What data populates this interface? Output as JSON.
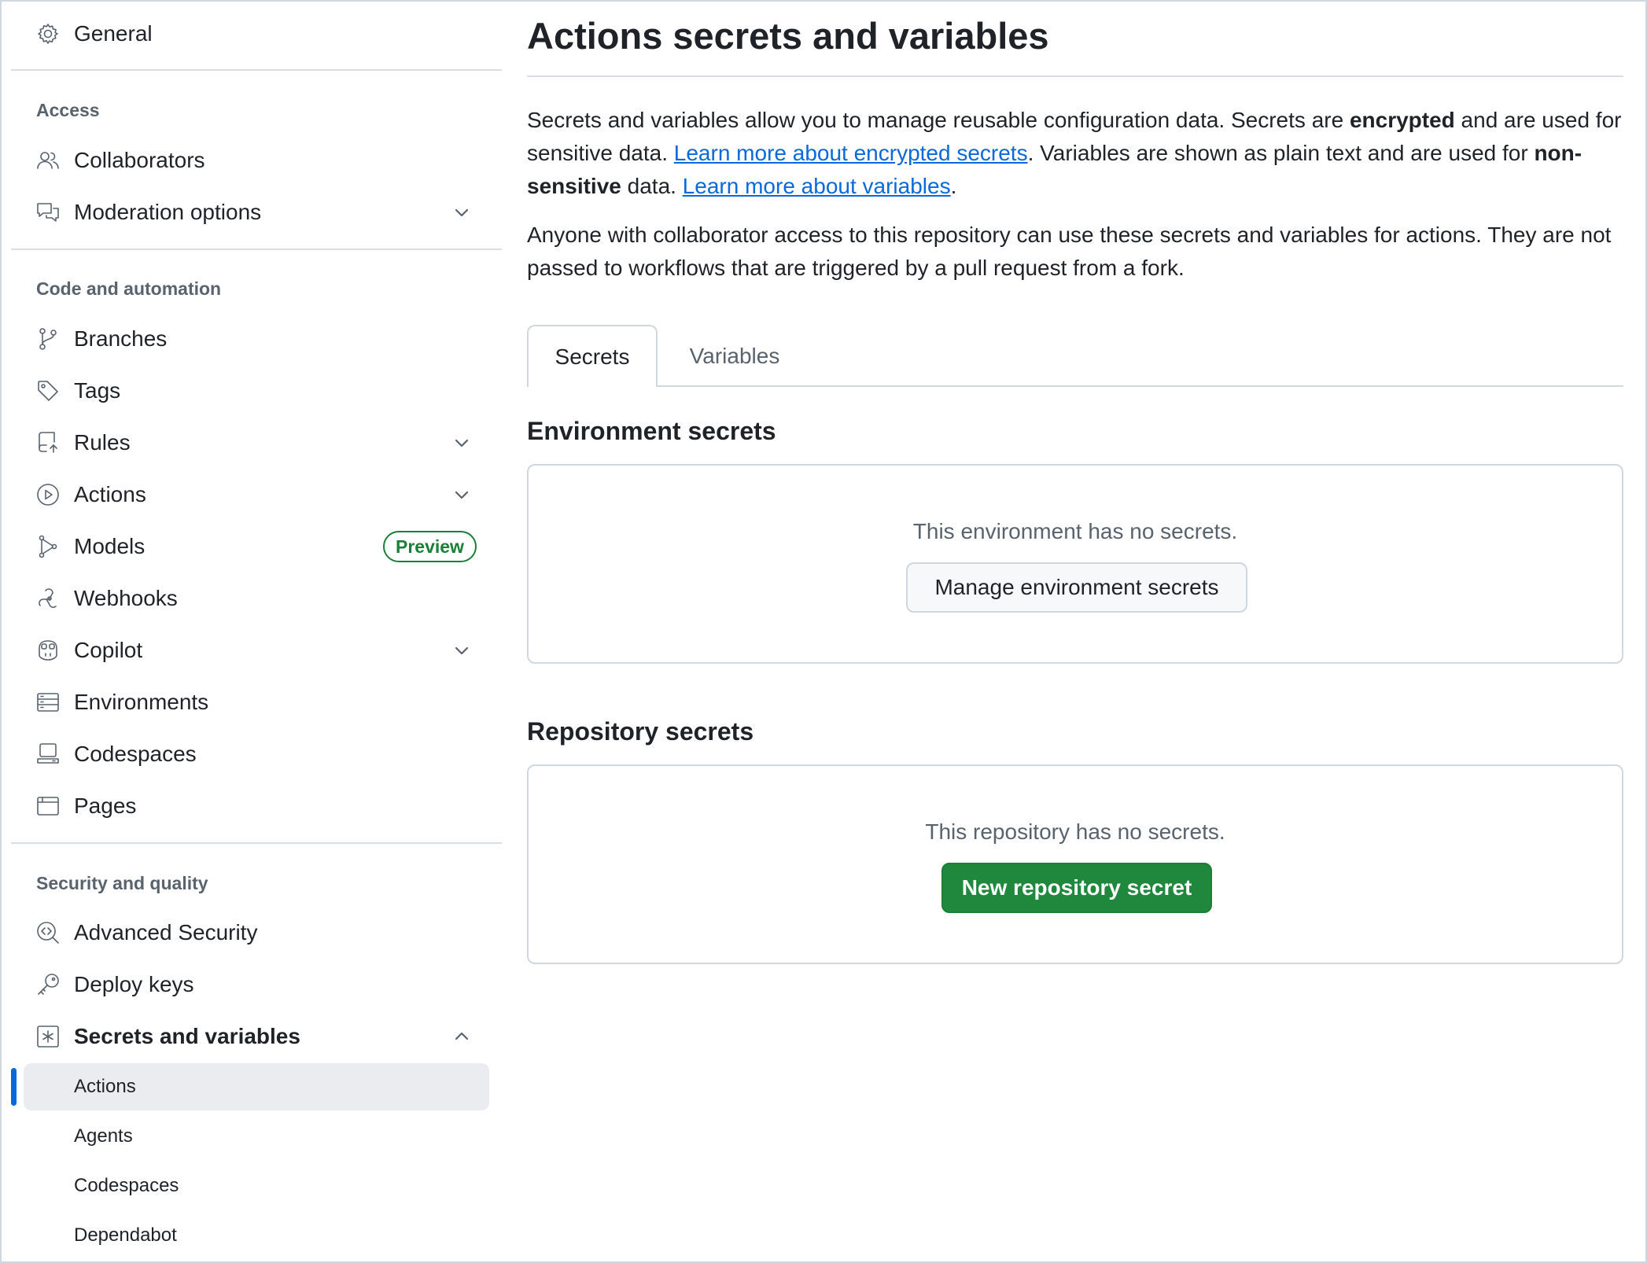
{
  "sidebar": {
    "general": "General",
    "sections": {
      "access": "Access",
      "code_automation": "Code and automation",
      "security_quality": "Security and quality"
    },
    "items": {
      "collaborators": "Collaborators",
      "moderation": "Moderation options",
      "branches": "Branches",
      "tags": "Tags",
      "rules": "Rules",
      "actions": "Actions",
      "models": "Models",
      "models_badge": "Preview",
      "webhooks": "Webhooks",
      "copilot": "Copilot",
      "environments": "Environments",
      "codespaces": "Codespaces",
      "pages": "Pages",
      "advanced_security": "Advanced Security",
      "deploy_keys": "Deploy keys",
      "secrets_variables": "Secrets and variables"
    },
    "sub_items": {
      "actions": "Actions",
      "agents": "Agents",
      "codespaces": "Codespaces",
      "dependabot": "Dependabot"
    },
    "icons": [
      "gear-icon",
      "people-icon",
      "comment-discussion-icon",
      "git-branch-icon",
      "tag-icon",
      "repo-push-icon",
      "play-icon",
      "ai-model-icon",
      "webhook-icon",
      "copilot-icon",
      "server-icon",
      "codespaces-icon",
      "browser-icon",
      "shield-search-icon",
      "key-icon",
      "key-asterisk-icon"
    ]
  },
  "main": {
    "title": "Actions secrets and variables",
    "intro": {
      "p1_a": "Secrets and variables allow you to manage reusable configuration data. Secrets are ",
      "p1_b": "encrypted",
      "p1_c": " and are used for sensitive data. ",
      "p1_link1": "Learn more about encrypted secrets",
      "p1_d": ". Variables are shown as plain text and are used for ",
      "p1_e": "non-sensitive",
      "p1_f": " data. ",
      "p1_link2": "Learn more about variables",
      "p1_g": ".",
      "p2": "Anyone with collaborator access to this repository can use these secrets and variables for actions. They are not passed to workflows that are triggered by a pull request from a fork."
    },
    "tabs": [
      "Secrets",
      "Variables"
    ],
    "environment": {
      "heading": "Environment secrets",
      "empty": "This environment has no secrets.",
      "button": "Manage environment secrets"
    },
    "repository": {
      "heading": "Repository secrets",
      "empty": "This repository has no secrets.",
      "button": "New repository secret"
    }
  },
  "colors": {
    "link": "#0969da",
    "primary_button": "#1f883d",
    "badge_green": "#1a7f37",
    "active_indicator": "#0969da",
    "muted_text": "#59636e"
  }
}
